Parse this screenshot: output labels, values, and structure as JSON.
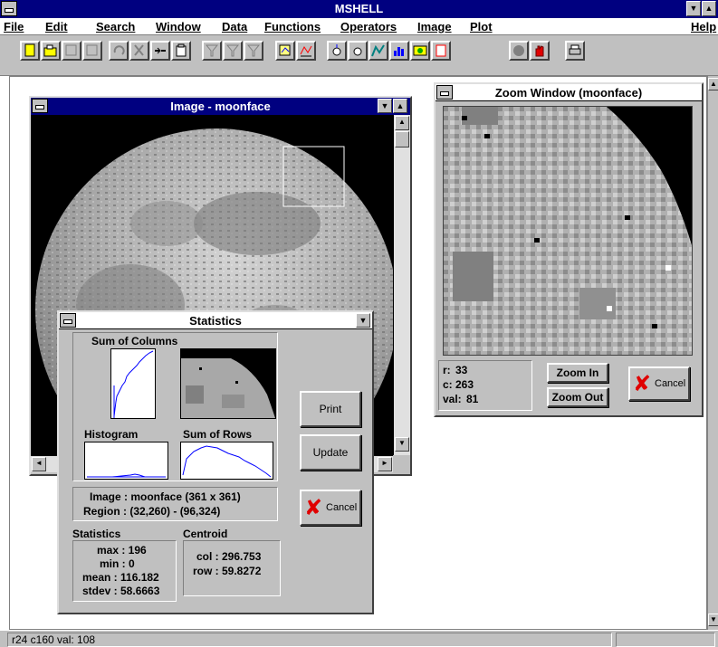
{
  "app": {
    "title": "MSHELL",
    "help_menu": "Help"
  },
  "menu": [
    {
      "label": "File"
    },
    {
      "label": "Edit"
    },
    {
      "label": "Search"
    },
    {
      "label": "Window"
    },
    {
      "label": "Data"
    },
    {
      "label": "Functions"
    },
    {
      "label": "Operators"
    },
    {
      "label": "Image"
    },
    {
      "label": "Plot"
    }
  ],
  "image_window": {
    "title": "Image - moonface"
  },
  "zoom_window": {
    "title": "Zoom Window (moonface)",
    "r_label": "r:",
    "r_value": "33",
    "c_label": "c:",
    "c_value": "263",
    "val_label": "val:",
    "val_value": "81",
    "zoom_in": "Zoom In",
    "zoom_out": "Zoom Out",
    "cancel": "Cancel"
  },
  "stats_window": {
    "title": "Statistics",
    "sum_columns_label": "Sum of Columns",
    "histogram_label": "Histogram",
    "sum_rows_label": "Sum of Rows",
    "print": "Print",
    "update": "Update",
    "cancel": "Cancel",
    "image_line": "Image :  moonface (361 x 361)",
    "region_line": "Region :  (32,260) - (96,324)",
    "statistics_header": "Statistics",
    "centroid_header": "Centroid",
    "max": "max : 196",
    "min": "min : 0",
    "mean": "mean : 116.182",
    "stdev": "stdev : 58.6663",
    "col": "col : 296.753",
    "row": "row : 59.8272"
  },
  "status": {
    "text": "r24 c160 val: 108"
  },
  "colors": {
    "title_active": "#000080",
    "face": "#c0c0c0",
    "plot_line": "#0000ff"
  }
}
